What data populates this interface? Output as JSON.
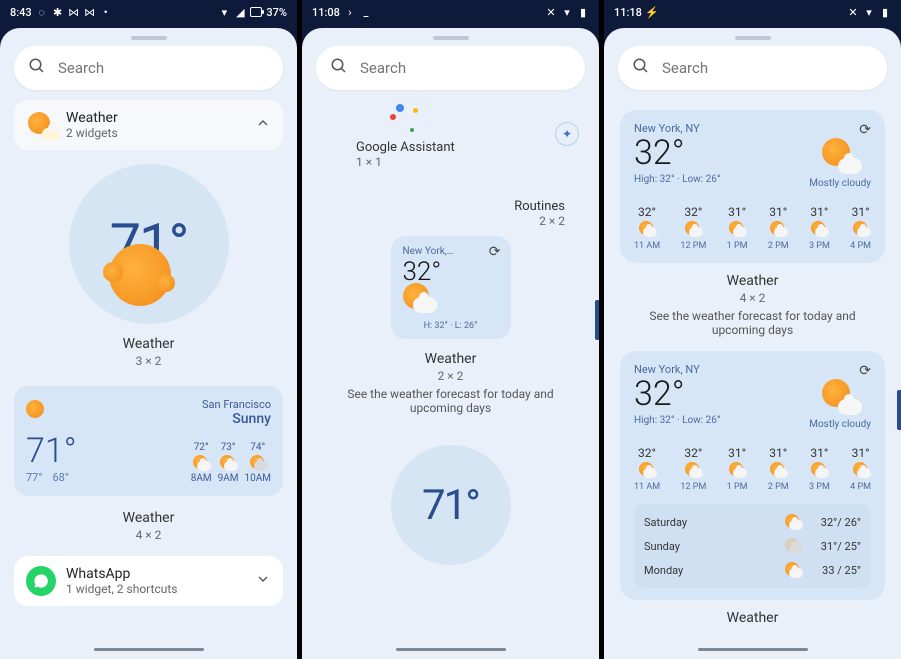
{
  "phone1": {
    "status": {
      "time": "8:43",
      "battery": "37%"
    },
    "search": {
      "placeholder": "Search"
    },
    "weather_header": {
      "title": "Weather",
      "subtitle": "2 widgets"
    },
    "preview1": {
      "temp": "71°",
      "label": "Weather",
      "size": "3 × 2"
    },
    "card": {
      "location": "San Francisco",
      "condition": "Sunny",
      "temp": "71°",
      "hi": "77°",
      "lo": "68°",
      "hours": [
        {
          "t": "72°",
          "time": "8AM"
        },
        {
          "t": "73°",
          "time": "9AM"
        },
        {
          "t": "74°",
          "time": "10AM"
        }
      ]
    },
    "preview2": {
      "label": "Weather",
      "size": "4 × 2"
    },
    "whatsapp": {
      "title": "WhatsApp",
      "subtitle": "1 widget, 2 shortcuts"
    }
  },
  "phone2": {
    "status": {
      "time": "11:08"
    },
    "search": {
      "placeholder": "Search"
    },
    "assistant": {
      "label": "Google Assistant",
      "size": "1 × 1"
    },
    "routines": {
      "label": "Routines",
      "size": "2 × 2"
    },
    "weather_small": {
      "location": "New York,…",
      "temp": "32°",
      "hilo": "H: 32° · L: 26°"
    },
    "weather_label": {
      "label": "Weather",
      "size": "2 × 2",
      "desc": "See the weather forecast for today and upcoming days"
    },
    "partial_temp": "71°"
  },
  "phone3": {
    "status": {
      "time": "11:18"
    },
    "search": {
      "placeholder": "Search"
    },
    "widget4x2": {
      "location": "New York, NY",
      "temp": "32°",
      "hilo": "High: 32° · Low: 26°",
      "condition": "Mostly cloudy",
      "hours": [
        {
          "t": "32°",
          "time": "11 AM"
        },
        {
          "t": "32°",
          "time": "12 PM"
        },
        {
          "t": "31°",
          "time": "1 PM"
        },
        {
          "t": "31°",
          "time": "2 PM"
        },
        {
          "t": "31°",
          "time": "3 PM"
        },
        {
          "t": "31°",
          "time": "4 PM"
        }
      ]
    },
    "label4x2": {
      "label": "Weather",
      "size": "4 × 2",
      "desc": "See the weather forecast for today and upcoming days"
    },
    "widget5x3": {
      "location": "New York, NY",
      "temp": "32°",
      "hilo": "High: 32° · Low: 26°",
      "condition": "Mostly cloudy",
      "hours": [
        {
          "t": "32°",
          "time": "11 AM"
        },
        {
          "t": "32°",
          "time": "12 PM"
        },
        {
          "t": "31°",
          "time": "1 PM"
        },
        {
          "t": "31°",
          "time": "2 PM"
        },
        {
          "t": "31°",
          "time": "3 PM"
        },
        {
          "t": "31°",
          "time": "4 PM"
        }
      ],
      "days": [
        {
          "name": "Saturday",
          "range": "32°/ 26°",
          "icon": "partly"
        },
        {
          "name": "Sunday",
          "range": "31°/ 25°",
          "icon": "cloudy"
        },
        {
          "name": "Monday",
          "range": "33 / 25°",
          "icon": "partly"
        }
      ]
    },
    "bottom_label": "Weather"
  }
}
